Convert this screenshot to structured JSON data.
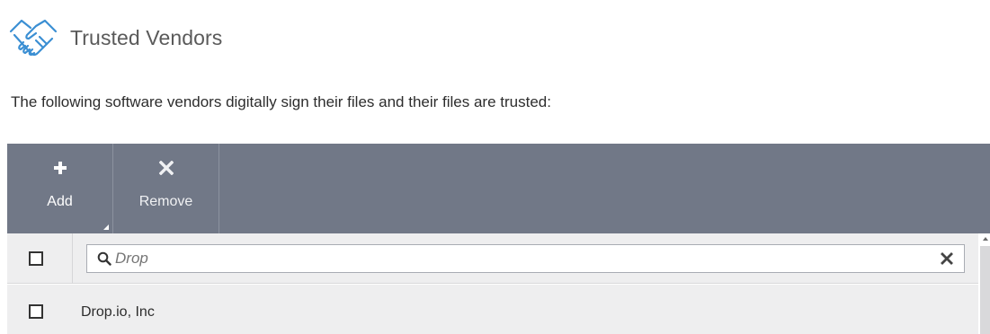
{
  "header": {
    "title": "Trusted Vendors",
    "icon": "handshake-icon"
  },
  "description": "The following software vendors digitally sign their files and their files are trusted:",
  "toolbar": {
    "add_label": "Add",
    "add_icon": "plus-icon",
    "remove_label": "Remove",
    "remove_icon": "x-icon"
  },
  "table": {
    "search": {
      "value": "",
      "placeholder": "Drop",
      "icon": "search-icon",
      "clear_icon": "clear-icon"
    },
    "rows": [
      {
        "name": "Drop.io, Inc",
        "checked": false
      }
    ]
  },
  "colors": {
    "toolbar_bg": "#717887",
    "row_bg": "#eeeeef",
    "logo_blue": "#3b8fd3"
  }
}
